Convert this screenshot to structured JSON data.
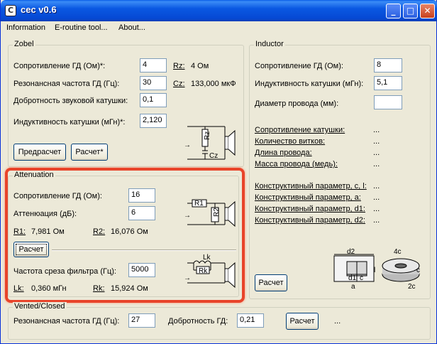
{
  "window": {
    "title": "cec v0.6",
    "app_icon": "C",
    "min": "_",
    "max": "□",
    "close": "✕"
  },
  "menu": [
    "Information",
    "E-routine tool...",
    "About..."
  ],
  "zobel": {
    "title": "Zobel",
    "rows": [
      {
        "label": "Сопротивление ГД (Ом)*:",
        "value": "4",
        "res_name": "Rz:",
        "res_value": "4 Ом"
      },
      {
        "label": "Резонансная частота ГД (Гц):",
        "value": "30",
        "res_name": "Cz:",
        "res_value": "133,000 мкФ"
      },
      {
        "label": "Добротность звуковой катушки:",
        "value": "0,1"
      },
      {
        "label": "Индуктивность катушки (мГн)*:",
        "value": "2,120"
      }
    ],
    "buttons": [
      "Предрасчет",
      "Расчет*"
    ],
    "schematic": {
      "r": "Rz",
      "c": "Cz",
      "arrow": "→"
    }
  },
  "attenuation": {
    "title": "Attenuation",
    "rows": [
      {
        "label": "Сопротивление ГД (Ом):",
        "value": "16"
      },
      {
        "label": "Аттенюация (дБ):",
        "value": "6"
      }
    ],
    "r1_name": "R1:",
    "r1_value": "7,981 Ом",
    "r2_name": "R2:",
    "r2_value": "16,076 Ом",
    "button": "Расчет",
    "cut_label": "Частота среза фильтра (Гц):",
    "cut_value": "5000",
    "lk_name": "Lk:",
    "lk_value": "0,360 мГн",
    "rk_name": "Rk:",
    "rk_value": "15,924 Ом",
    "schematic1": {
      "r1": "R1",
      "r2": "R2",
      "arrow": "→"
    },
    "schematic2": {
      "lk": "Lk",
      "rk": "Rk",
      "arrow": "→"
    }
  },
  "inductor": {
    "title": "Inductor",
    "rows": [
      {
        "label": "Сопротивление ГД (Ом):",
        "value": "8"
      },
      {
        "label": "Индуктивность катушки (мГн):",
        "value": "5,1"
      },
      {
        "label": "Диаметр провода (мм):",
        "value": ""
      }
    ],
    "results1": [
      {
        "label": "Сопротивление катушки:",
        "value": "..."
      },
      {
        "label": "Количество витков:",
        "value": "..."
      },
      {
        "label": "Длина провода:",
        "value": "..."
      },
      {
        "label": "Масса провода (медь):",
        "value": "..."
      }
    ],
    "results2": [
      {
        "label": "Конструктивный параметр, c, l:",
        "value": "..."
      },
      {
        "label": "Конструктивный параметр, a:",
        "value": "..."
      },
      {
        "label": "Конструктивный параметр, d1:",
        "value": "..."
      },
      {
        "label": "Конструктивный параметр, d2:",
        "value": "..."
      }
    ],
    "button": "Расчет",
    "diagram": {
      "d2": "d2",
      "d1": "d1",
      "c": "c",
      "a": "a",
      "l": "l",
      "c4": "4c",
      "c2": "2c",
      "c_side": "c"
    }
  },
  "vented": {
    "title": "Vented/Closed",
    "res_label": "Резонансная частота ГД (Гц):",
    "res_value": "27",
    "q_label": "Добротность ГД:",
    "q_value": "0,21",
    "button": "Расчет",
    "result": "..."
  },
  "colors": {
    "titlebar": "#0a58e2",
    "highlight": "#e8442a",
    "face": "#ece9d8"
  }
}
